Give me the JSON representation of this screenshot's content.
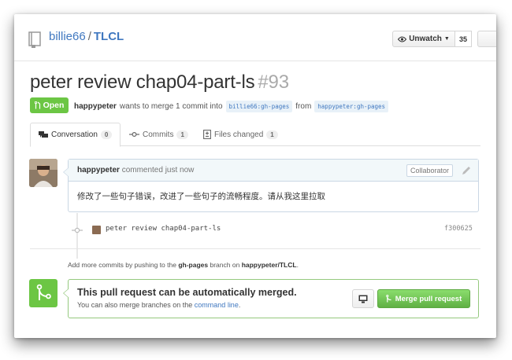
{
  "repo": {
    "owner": "billie66",
    "separator": "/",
    "name": "TLCL",
    "unwatch_label": "Unwatch",
    "watch_count": "35",
    "icon": "repo-icon"
  },
  "pr": {
    "title": "peter review chap04-part-ls",
    "number": "#93",
    "state": "Open",
    "author": "happypeter",
    "meta_text": "wants to merge 1 commit into",
    "base_branch": "billie66:gh-pages",
    "from_text": "from",
    "head_branch": "happypeter:gh-pages"
  },
  "tabs": [
    {
      "label": "Conversation",
      "count": "0",
      "icon": "comment-discussion-icon",
      "active": true
    },
    {
      "label": "Commits",
      "count": "1",
      "icon": "git-commit-icon",
      "active": false
    },
    {
      "label": "Files changed",
      "count": "1",
      "icon": "diff-icon",
      "active": false
    }
  ],
  "comment": {
    "author": "happypeter",
    "action": "commented just now",
    "role": "Collaborator",
    "body": "修改了一些句子错误，改进了一些句子的流畅程度。请从我这里拉取"
  },
  "commit": {
    "message": "peter review chap04-part-ls",
    "sha": "f300625"
  },
  "hint": {
    "prefix": "Add more commits by pushing to the",
    "branch": "gh-pages",
    "middle": "branch on",
    "repo": "happypeter/TLCL",
    "suffix": "."
  },
  "merge": {
    "title": "This pull request can be automatically merged.",
    "sub_prefix": "You can also merge branches on the",
    "sub_link": "command line",
    "sub_suffix": ".",
    "button_label": "Merge pull request",
    "accent": "#6cc644"
  }
}
